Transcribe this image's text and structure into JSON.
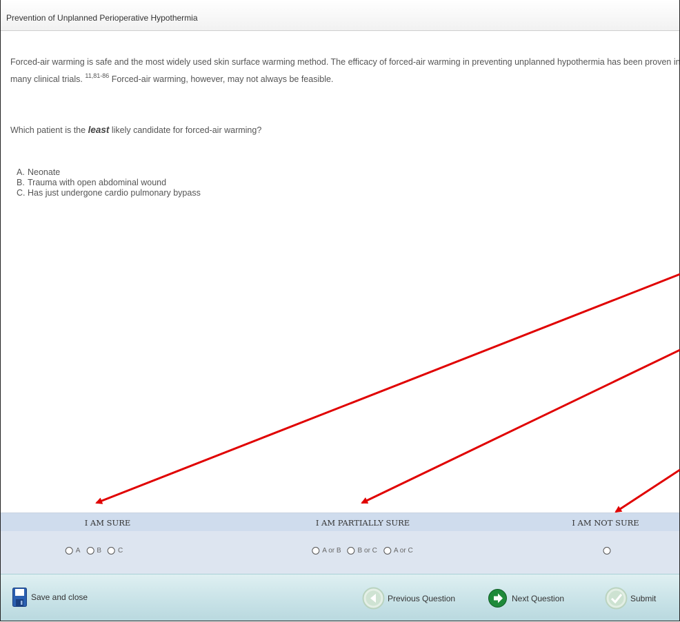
{
  "window": {
    "title": "Prevention of Unplanned Perioperative Hypothermia"
  },
  "content": {
    "intro_part1": "Forced-air warming is safe and the most widely used skin surface warming method. The efficacy of forced-air warming in preventing unplanned hypothermia has been proven in many clinical trials.",
    "intro_citation": "11,81-86",
    "intro_part2": " Forced-air warming, however, may not always be feasible.",
    "question_prefix": "Which patient is the ",
    "question_emphasis": "least",
    "question_suffix": " likely candidate for forced-air warming?",
    "options": [
      {
        "letter": "A.",
        "text": "Neonate"
      },
      {
        "letter": "B.",
        "text": "Trauma with open abdominal wound"
      },
      {
        "letter": "C.",
        "text": "Has just undergone cardio pulmonary bypass"
      }
    ]
  },
  "confidence": {
    "groups": [
      {
        "label": "I AM SURE",
        "choices": [
          "A",
          "B",
          "C"
        ]
      },
      {
        "label": "I AM PARTIALLY SURE",
        "choices": [
          "A or B",
          "B or C",
          "A or C"
        ]
      },
      {
        "label": "I AM NOT SURE",
        "choices": [
          ""
        ]
      }
    ]
  },
  "footer": {
    "save_label": "Save and close",
    "previous_label": "Previous Question",
    "next_label": "Next Question",
    "submit_label": "Submit"
  },
  "icons": {
    "save": "floppy-disk-icon",
    "previous": "arrow-left-circle-icon",
    "next": "arrow-right-circle-icon",
    "submit": "checkmark-circle-icon"
  },
  "colors": {
    "annotation_arrow": "#e00000",
    "answer_header_bg": "#cfdced",
    "answer_panel_bg": "#dde5f0",
    "footer_bg": "#c6e1e6",
    "next_icon_green": "#1f8a3a",
    "save_icon_blue": "#2a5fb0"
  }
}
